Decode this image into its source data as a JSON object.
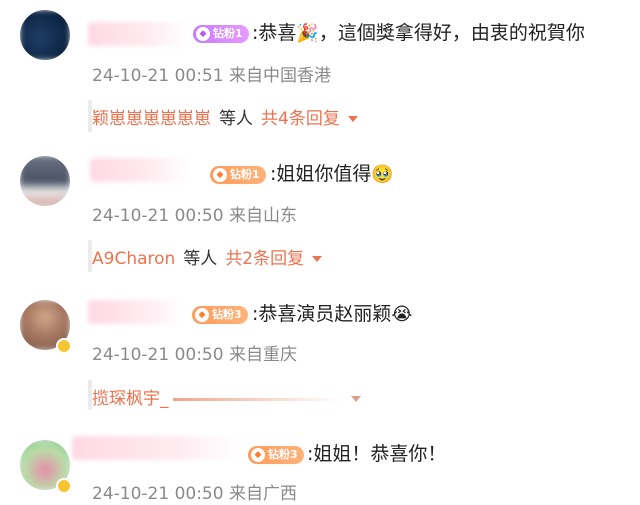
{
  "comments": [
    {
      "text": ":恭喜",
      "emoji": "🎉",
      "text_after": "，這個獎拿得好，由衷的祝賀你",
      "badge": "钻粉1",
      "meta": "24-10-21 00:51 来自中国香港",
      "reply": {
        "names": "颖崽崽崽崽崽崽",
        "others": "等人",
        "count": "共4条回复"
      }
    },
    {
      "text": ":姐姐你值得",
      "emoji": "🥹",
      "badge": "钻粉1",
      "meta": "24-10-21 00:50 来自山东",
      "reply": {
        "names": "A9Charon",
        "others": "等人",
        "count": "共2条回复"
      }
    },
    {
      "text": ":恭喜演员赵丽颖",
      "emoji": "😭",
      "badge": "钻粉3",
      "meta": "24-10-21 00:50 来自重庆",
      "reply": {
        "names": "揽琛枫宇_"
      }
    },
    {
      "text": ":姐姐！恭喜你！",
      "badge": "钻粉3",
      "meta": "24-10-21 00:50 来自广西"
    }
  ],
  "colors": {
    "accent": "#eb7350",
    "meta": "#8a8a8a",
    "badge_purple": "#c87bff",
    "badge_orange": "#ff9a5a"
  },
  "icons": {
    "fan_badge": "diamond-icon",
    "dropdown": "chevron-down-icon",
    "verified": "verified-icon"
  }
}
